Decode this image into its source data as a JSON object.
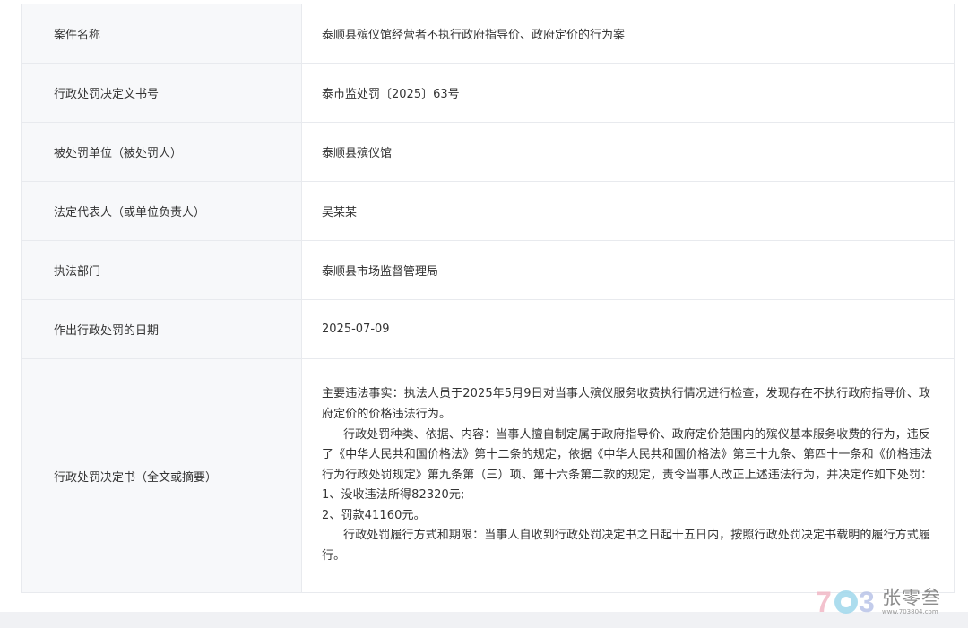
{
  "rows": [
    {
      "label": "案件名称",
      "value": "泰顺县殡仪馆经营者不执行政府指导价、政府定价的行为案"
    },
    {
      "label": "行政处罚决定文书号",
      "value": "泰市监处罚〔2025〕63号"
    },
    {
      "label": "被处罚单位（被处罚人）",
      "value": "泰顺县殡仪馆"
    },
    {
      "label": "法定代表人（或单位负责人）",
      "value": "吴某某"
    },
    {
      "label": "执法部门",
      "value": "泰顺县市场监督管理局"
    },
    {
      "label": "作出行政处罚的日期",
      "value": "2025-07-09"
    }
  ],
  "decision": {
    "label": "行政处罚决定书（全文或摘要）",
    "paragraphs": [
      "主要违法事实：执法人员于2025年5月9日对当事人殡仪服务收费执行情况进行检查，发现存在不执行政府指导价、政府定价的价格违法行为。",
      "行政处罚种类、依据、内容：当事人擅自制定属于政府指导价、政府定价范围内的殡仪基本服务收费的行为，违反了《中华人民共和国价格法》第十二条的规定，依据《中华人民共和国价格法》第三十九条、第四十一条和《价格违法行为行政处罚规定》第九条第（三）项、第十六条第二款的规定，责令当事人改正上述违法行为，并决定作如下处罚：",
      "1、没收违法所得82320元;",
      "2、罚款41160元。",
      "行政处罚履行方式和期限：当事人自收到行政处罚决定书之日起十五日内，按照行政处罚决定书载明的履行方式履行。"
    ]
  },
  "watermark": {
    "logo_text": "703",
    "name": "张零叁",
    "url": "www.703804.com"
  }
}
